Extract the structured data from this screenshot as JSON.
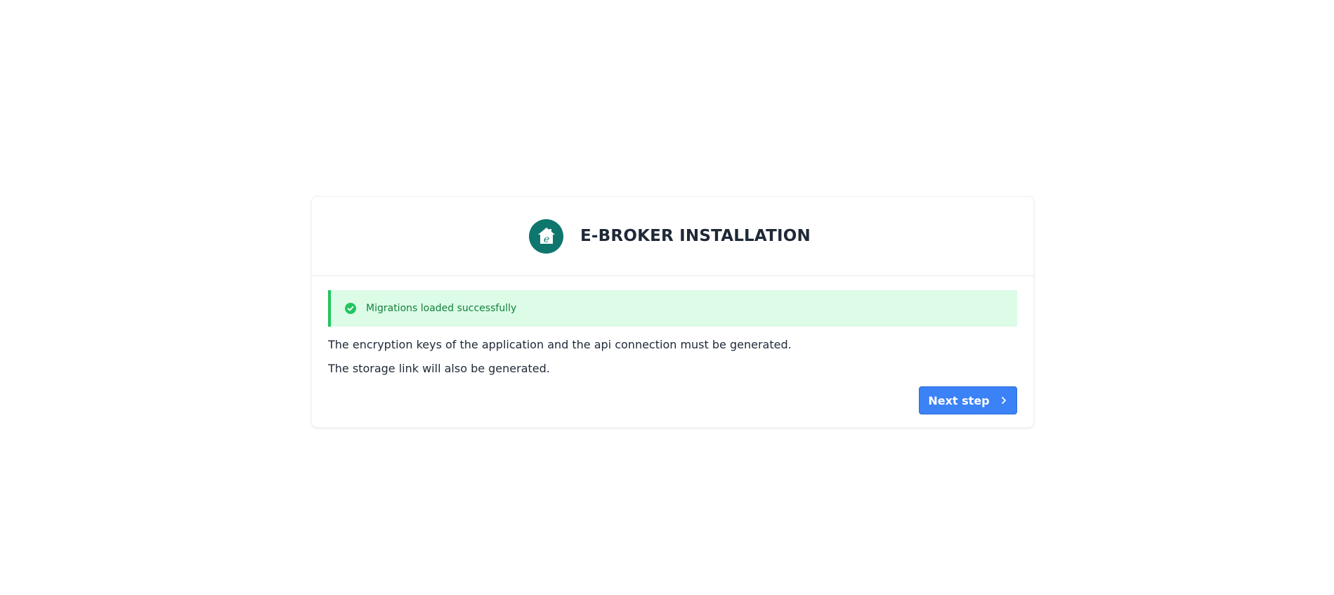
{
  "header": {
    "title": "E-BROKER INSTALLATION",
    "logo_icon": "house-e-logo-icon",
    "logo_letter": "e",
    "logo_color": "#0f766e"
  },
  "alert": {
    "icon": "check-circle-icon",
    "text": "Migrations loaded successfully",
    "background_color": "#dcfce7",
    "accent_color": "#22c55e",
    "text_color": "#15803d"
  },
  "body": {
    "paragraph_1": "The encryption keys of the application and the api connection must be generated.",
    "paragraph_2": "The storage link will also be generated."
  },
  "actions": {
    "next_label": "Next step",
    "next_icon": "chevron-right-icon",
    "button_color": "#3b82f6"
  }
}
